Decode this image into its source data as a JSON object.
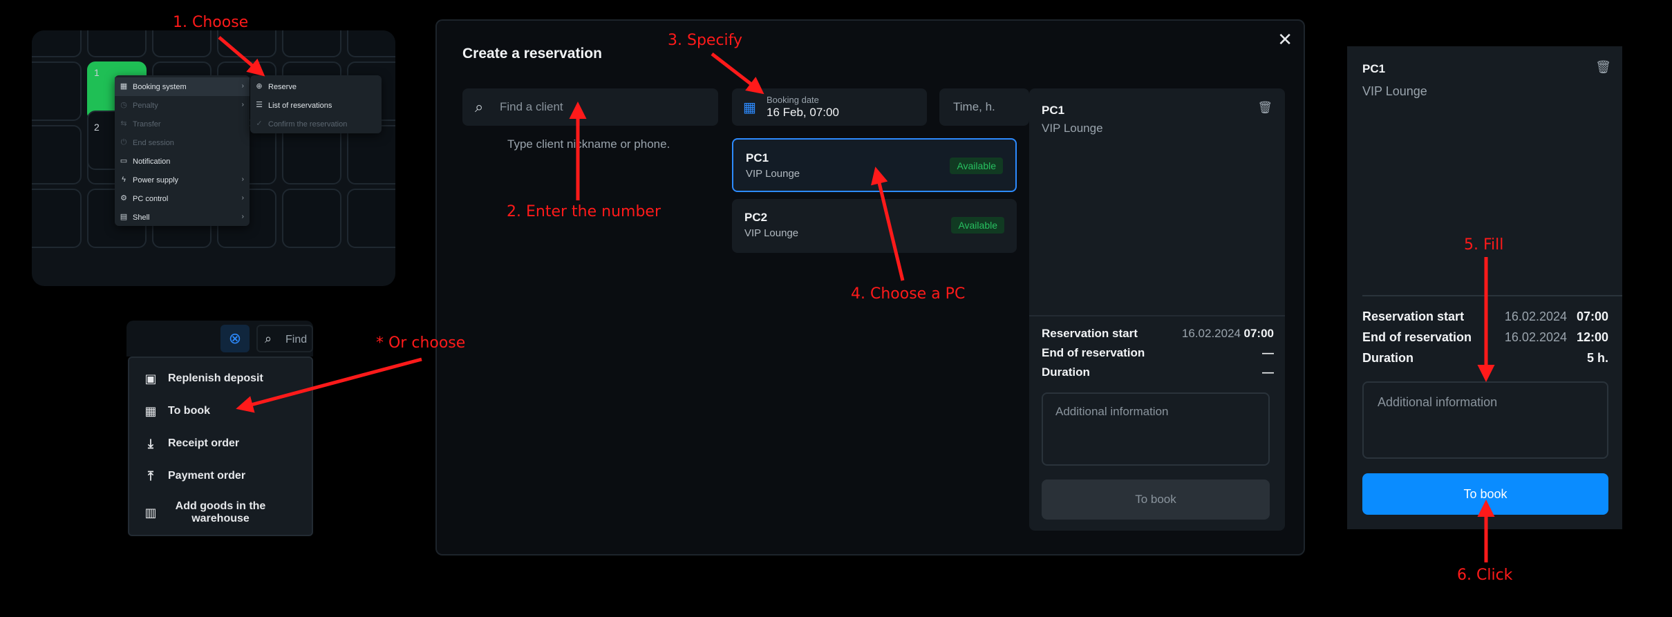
{
  "colors": {
    "annotation": "#ff1a1a",
    "accent": "#2d8bff",
    "available": "#27c060",
    "tile_selected": "#1fbf55"
  },
  "annotations": {
    "step1": "1. Choose",
    "step2": "2. Enter the number",
    "step3": "3. Specify",
    "step4": "4. Choose a PC",
    "step5": "5. Fill",
    "step6": "6. Click",
    "alt": "* Or choose"
  },
  "grid": {
    "tile1": "1",
    "tile2": "2",
    "context_menu": [
      {
        "label": "Booking system",
        "icon": "calendar-icon",
        "chevron": "›"
      },
      {
        "label": "Penalty",
        "icon": "clock-icon",
        "chevron": "›"
      },
      {
        "label": "Transfer",
        "icon": "transfer-icon"
      },
      {
        "label": "End session",
        "icon": "power-icon"
      },
      {
        "label": "Notification",
        "icon": "chat-icon"
      },
      {
        "label": "Power supply",
        "icon": "bolt-icon",
        "chevron": "›"
      },
      {
        "label": "PC control",
        "icon": "gear-icon",
        "chevron": "›"
      },
      {
        "label": "Shell",
        "icon": "window-icon",
        "chevron": "›"
      }
    ],
    "submenu": [
      {
        "label": "Reserve",
        "icon": "plus-circle-icon"
      },
      {
        "label": "List of reservations",
        "icon": "list-icon"
      },
      {
        "label": "Confirm the reservation",
        "icon": "check-icon"
      }
    ]
  },
  "client_menu": {
    "search_placeholder": "Find",
    "items": [
      {
        "label": "Replenish deposit",
        "icon": "wallet-icon"
      },
      {
        "label": "To book",
        "icon": "calendar-icon"
      },
      {
        "label": "Receipt order",
        "icon": "download-icon"
      },
      {
        "label": "Payment order",
        "icon": "upload-icon"
      },
      {
        "label": "Add goods in the warehouse",
        "icon": "barcode-icon"
      }
    ]
  },
  "modal": {
    "title": "Create a reservation",
    "client_search_placeholder": "Find a client",
    "client_hint": "Type client nickname or phone.",
    "booking_date_label": "Booking date",
    "booking_date_value": "16 Feb, 07:00",
    "time_placeholder": "Time, h.",
    "pcs": [
      {
        "name": "PC1",
        "zone": "VIP Lounge",
        "status": "Available",
        "selected": true
      },
      {
        "name": "PC2",
        "zone": "VIP Lounge",
        "status": "Available",
        "selected": false
      }
    ],
    "summary": {
      "pc": "PC1",
      "zone": "VIP Lounge",
      "start_label": "Reservation start",
      "start_date": "16.02.2024",
      "start_time": "07:00",
      "end_label": "End of reservation",
      "end_value": "—",
      "duration_label": "Duration",
      "duration_value": "—",
      "additional_placeholder": "Additional information",
      "book_button": "To book"
    }
  },
  "filled_summary": {
    "pc": "PC1",
    "zone": "VIP Lounge",
    "start_label": "Reservation start",
    "start_date": "16.02.2024",
    "start_time": "07:00",
    "end_label": "End of reservation",
    "end_date": "16.02.2024",
    "end_time": "12:00",
    "duration_label": "Duration",
    "duration_value": "5 h.",
    "additional_placeholder": "Additional information",
    "book_button": "To book"
  }
}
